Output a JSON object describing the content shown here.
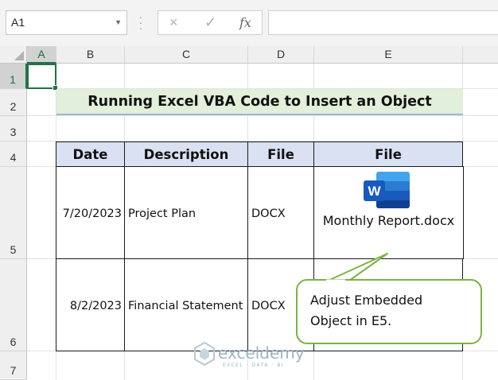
{
  "formula_bar": {
    "name_box": "A1",
    "cancel_icon": "×",
    "enter_icon": "✓",
    "fx_label": "fx",
    "formula": ""
  },
  "columns": [
    "A",
    "B",
    "C",
    "D",
    "E"
  ],
  "rows": [
    "1",
    "2",
    "3",
    "4",
    "5",
    "6",
    "7"
  ],
  "selected_cell": "A1",
  "title": "Running Excel VBA Code to Insert an Object",
  "table": {
    "headers": [
      "Date",
      "Description",
      "File Type",
      "File"
    ],
    "rows": [
      {
        "date": "7/20/2023",
        "description": "Project Plan",
        "file_type": "DOCX",
        "file": "Monthly Report.docx"
      },
      {
        "date": "8/2/2023",
        "description": "Financial Statement",
        "file_type": "DOCX",
        "file": ""
      }
    ]
  },
  "embedded_object": {
    "caption": "Monthly Report.docx",
    "icon": "word-icon",
    "icon_letter": "W"
  },
  "callout": {
    "line1": "Adjust Embedded",
    "line2": "Object in E5."
  },
  "watermark": {
    "name": "exceldemy",
    "tagline": "EXCEL · DATA · BI"
  },
  "colors": {
    "selection_green": "#217346",
    "title_fill": "#e2efda",
    "header_fill": "#d9e1f2",
    "callout_border": "#7cb342",
    "word_blue": "#185abd"
  }
}
